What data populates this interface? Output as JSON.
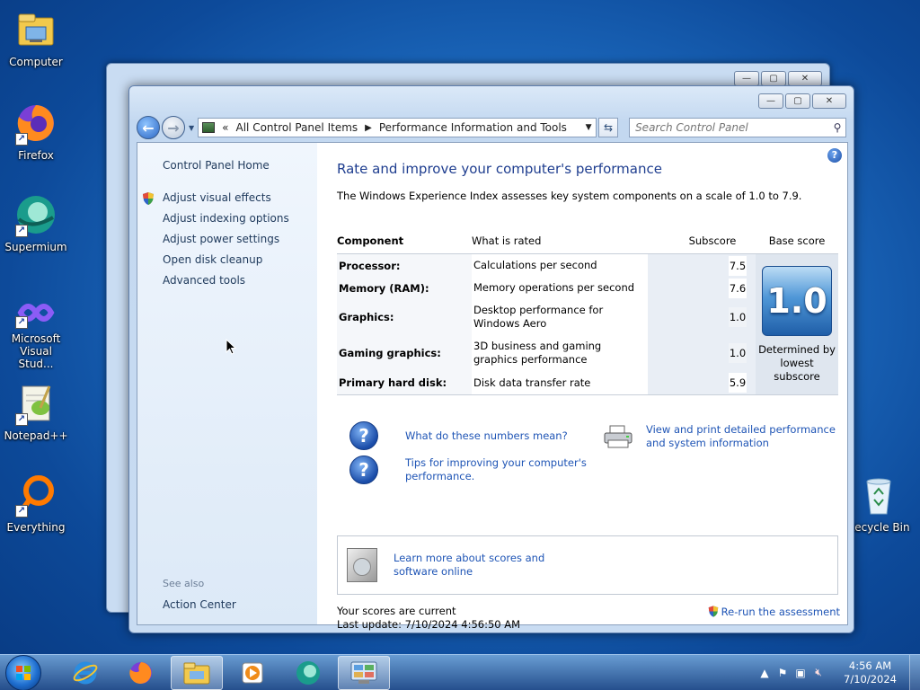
{
  "desktop": {
    "icons": [
      {
        "label": "Computer",
        "icon": "computer-icon"
      },
      {
        "label": "Firefox",
        "icon": "firefox-icon"
      },
      {
        "label": "Supermium",
        "icon": "supermium-icon"
      },
      {
        "label": "Microsoft Visual Stud...",
        "icon": "visual-studio-icon"
      },
      {
        "label": "Notepad++",
        "icon": "notepad-plus-plus-icon"
      },
      {
        "label": "Everything",
        "icon": "everything-icon"
      },
      {
        "label": "Recycle Bin",
        "icon": "recycle-bin-icon"
      }
    ]
  },
  "window": {
    "minimize": "—",
    "maximize": "▢",
    "close": "✕",
    "address": {
      "root_chevron": "«",
      "crumb1": "All Control Panel Items",
      "crumb2": "Performance Information and Tools"
    },
    "search_placeholder": "Search Control Panel"
  },
  "left_pane": {
    "home": "Control Panel Home",
    "links": [
      "Adjust visual effects",
      "Adjust indexing options",
      "Adjust power settings",
      "Open disk cleanup",
      "Advanced tools"
    ],
    "see_also": "See also",
    "action_center": "Action Center"
  },
  "main": {
    "title": "Rate and improve your computer's performance",
    "intro": "The Windows Experience Index assesses key system components on a scale of 1.0 to 7.9.",
    "headers": {
      "component": "Component",
      "what": "What is rated",
      "subscore": "Subscore",
      "base": "Base score"
    },
    "rows": [
      {
        "component": "Processor:",
        "what": "Calculations per second",
        "subscore": "7.5"
      },
      {
        "component": "Memory (RAM):",
        "what": "Memory operations per second",
        "subscore": "7.6"
      },
      {
        "component": "Graphics:",
        "what": "Desktop performance for Windows Aero",
        "subscore": "1.0"
      },
      {
        "component": "Gaming graphics:",
        "what": "3D business and gaming graphics performance",
        "subscore": "1.0"
      },
      {
        "component": "Primary hard disk:",
        "what": "Disk data transfer rate",
        "subscore": "5.9"
      }
    ],
    "base_score": "1.0",
    "base_note": "Determined by lowest subscore",
    "link_numbers": "What do these numbers mean?",
    "link_tips": "Tips for improving your computer's performance.",
    "link_print": "View and print detailed performance and system information",
    "link_learn": "Learn more about scores and software online",
    "status_current": "Your scores are current",
    "status_update": "Last update: 7/10/2024 4:56:50 AM",
    "rerun": "Re-run the assessment"
  },
  "taskbar": {
    "apps": [
      "internet-explorer-icon",
      "firefox-icon",
      "explorer-icon",
      "media-player-icon",
      "supermium-icon",
      "control-panel-icon"
    ],
    "time": "4:56 AM",
    "date": "7/10/2024"
  }
}
